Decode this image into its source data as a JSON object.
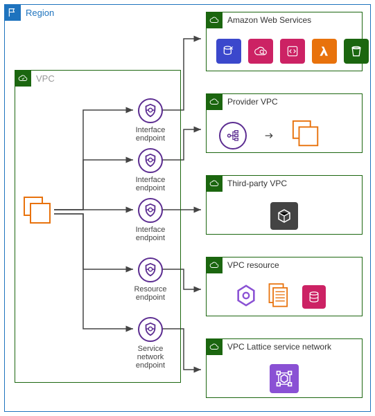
{
  "region": {
    "label": "Region"
  },
  "vpc": {
    "label": "VPC"
  },
  "endpoints": {
    "e1": "Interface\nendpoint",
    "e2": "Interface\nendpoint",
    "e3": "Interface\nendpoint",
    "e4": "Resource\nendpoint",
    "e5": "Service\nnetwork\nendpoint"
  },
  "targets": {
    "aws": {
      "label": "Amazon Web Services"
    },
    "provider": {
      "label": "Provider VPC"
    },
    "thirdparty": {
      "label": "Third-party VPC"
    },
    "resource": {
      "label": "VPC resource"
    },
    "lattice": {
      "label": "VPC Lattice service network"
    }
  },
  "colors": {
    "purple": "#5c2d91",
    "green": "#1b660f",
    "blue": "#1e73be",
    "orange": "#e8720c",
    "magenta": "#cc2264",
    "violet": "#8a51d4"
  },
  "icons": {
    "flag": "flag-icon",
    "cloud": "cloud-icon",
    "shield": "shield-endpoint-icon"
  }
}
